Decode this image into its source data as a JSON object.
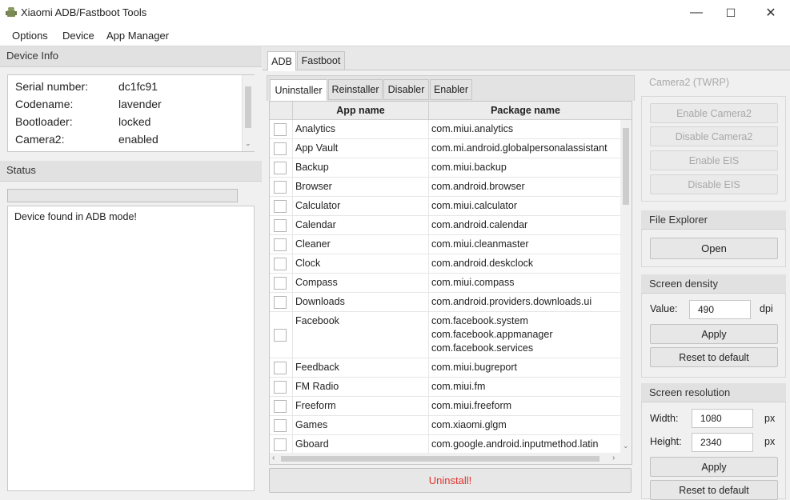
{
  "window": {
    "title": "Xiaomi ADB/Fastboot Tools",
    "controls": [
      "—",
      "☐",
      "✕"
    ]
  },
  "menu": [
    "Options",
    "Device",
    "App Manager"
  ],
  "device_info": {
    "header": "Device Info",
    "rows": [
      {
        "label": "Serial number:",
        "value": "dc1fc91"
      },
      {
        "label": "Codename:",
        "value": "lavender"
      },
      {
        "label": "Bootloader:",
        "value": "locked"
      },
      {
        "label": "Camera2:",
        "value": "enabled"
      }
    ]
  },
  "status": {
    "header": "Status",
    "progress": 0,
    "log": "Device found in ADB mode!"
  },
  "main_tabs": [
    "ADB",
    "Fastboot"
  ],
  "sub_tabs": [
    "Uninstaller",
    "Reinstaller",
    "Disabler",
    "Enabler"
  ],
  "table": {
    "columns": [
      "App name",
      "Package name"
    ],
    "rows": [
      {
        "name": "Analytics",
        "packages": [
          "com.miui.analytics"
        ]
      },
      {
        "name": "App Vault",
        "packages": [
          "com.mi.android.globalpersonalassistant"
        ]
      },
      {
        "name": "Backup",
        "packages": [
          "com.miui.backup"
        ]
      },
      {
        "name": "Browser",
        "packages": [
          "com.android.browser"
        ]
      },
      {
        "name": "Calculator",
        "packages": [
          "com.miui.calculator"
        ]
      },
      {
        "name": "Calendar",
        "packages": [
          "com.android.calendar"
        ]
      },
      {
        "name": "Cleaner",
        "packages": [
          "com.miui.cleanmaster"
        ]
      },
      {
        "name": "Clock",
        "packages": [
          "com.android.deskclock"
        ]
      },
      {
        "name": "Compass",
        "packages": [
          "com.miui.compass"
        ]
      },
      {
        "name": "Downloads",
        "packages": [
          "com.android.providers.downloads.ui"
        ]
      },
      {
        "name": "Facebook",
        "packages": [
          "com.facebook.system",
          "com.facebook.appmanager",
          "com.facebook.services"
        ]
      },
      {
        "name": "Feedback",
        "packages": [
          "com.miui.bugreport"
        ]
      },
      {
        "name": "FM Radio",
        "packages": [
          "com.miui.fm"
        ]
      },
      {
        "name": "Freeform",
        "packages": [
          "com.miui.freeform"
        ]
      },
      {
        "name": "Games",
        "packages": [
          "com.xiaomi.glgm"
        ]
      },
      {
        "name": "Gboard",
        "packages": [
          "com.google.android.inputmethod.latin"
        ]
      }
    ]
  },
  "uninstall_button": "Uninstall!",
  "camera2": {
    "header": "Camera2 (TWRP)",
    "buttons": [
      "Enable Camera2",
      "Disable Camera2",
      "Enable EIS",
      "Disable EIS"
    ]
  },
  "file_explorer": {
    "header": "File Explorer",
    "button": "Open"
  },
  "screen_density": {
    "header": "Screen density",
    "label": "Value:",
    "value": "490",
    "unit": "dpi",
    "apply": "Apply",
    "reset": "Reset to default"
  },
  "screen_resolution": {
    "header": "Screen resolution",
    "width_label": "Width:",
    "width_value": "1080",
    "height_label": "Height:",
    "height_value": "2340",
    "unit": "px",
    "apply": "Apply",
    "reset": "Reset to default"
  }
}
